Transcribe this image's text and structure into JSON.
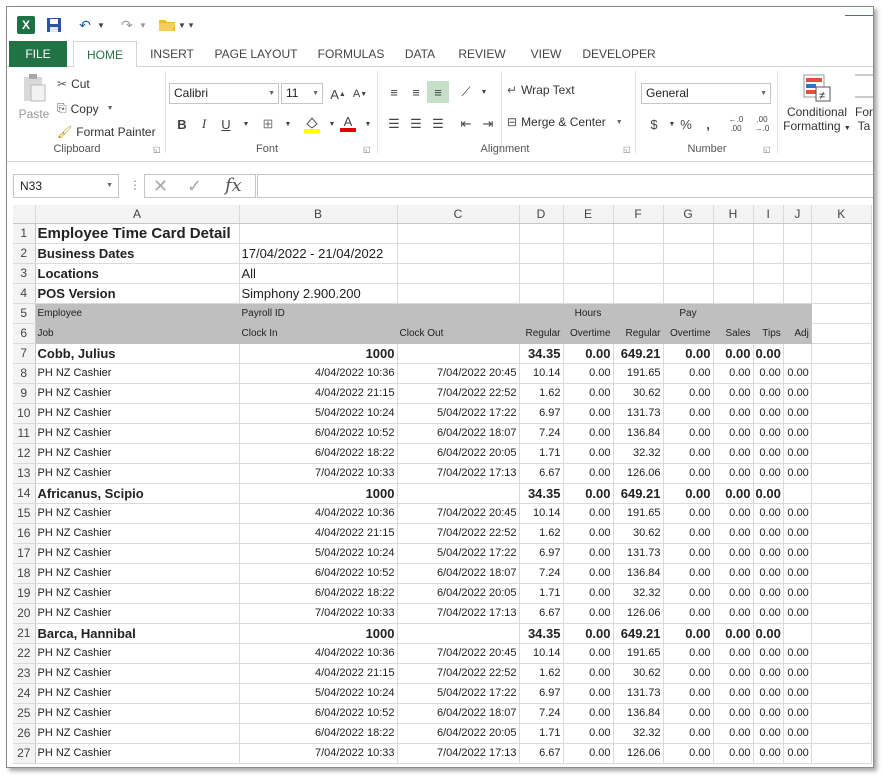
{
  "qat": {
    "app_icon": "X"
  },
  "tabs": [
    "FILE",
    "HOME",
    "INSERT",
    "PAGE LAYOUT",
    "FORMULAS",
    "DATA",
    "REVIEW",
    "VIEW",
    "DEVELOPER"
  ],
  "ribbon": {
    "paste": "Paste",
    "cut": "Cut",
    "copy": "Copy",
    "format_painter": "Format Painter",
    "clipboard": "Clipboard",
    "font_name": "Calibri",
    "font_size": "11",
    "grow": "A",
    "shrink": "A",
    "bold": "B",
    "italic": "I",
    "underline": "U",
    "font_color": "A",
    "font": "Font",
    "wrap_text": "Wrap Text",
    "merge_center": "Merge & Center",
    "alignment": "Alignment",
    "number_format": "General",
    "currency": "$",
    "percent": "%",
    "comma": ",",
    "inc_decimal": "←.0 .00",
    "dec_decimal": ".00 →.0",
    "number": "Number",
    "conditional": "Conditional",
    "formatting": "Formatting",
    "format_as": "For",
    "table": "Ta"
  },
  "formula_bar": {
    "name_box": "N33",
    "fx": "fx",
    "value": ""
  },
  "columns": [
    "A",
    "B",
    "C",
    "D",
    "E",
    "F",
    "G",
    "H",
    "I",
    "J",
    "K"
  ],
  "title": "Employee Time Card Detail",
  "info": [
    {
      "label": "Business Dates",
      "value": "17/04/2022 - 21/04/2022"
    },
    {
      "label": "Locations",
      "value": "All"
    },
    {
      "label": "POS Version",
      "value": "Simphony 2.900.200"
    }
  ],
  "header1": {
    "a": "Employee",
    "b": "Payroll ID",
    "hours": "Hours",
    "pay": "Pay"
  },
  "header2": {
    "a": "Job",
    "b": "Clock In",
    "c": "Clock Out",
    "d": "Regular",
    "e": "Overtime",
    "f": "Regular",
    "g": "Overtime",
    "h": "Sales",
    "i": "Tips",
    "j": "Adj"
  },
  "employees": [
    {
      "name": "Cobb, Julius",
      "payroll_id": "1000",
      "reg_hours": "34.35",
      "ot_hours": "0.00",
      "reg_pay": "649.21",
      "ot_pay": "0.00",
      "sales": "0.00",
      "tips": "0.00",
      "rows": [
        {
          "job": "PH NZ Cashier",
          "in": "4/04/2022 10:36",
          "out": "7/04/2022 20:45",
          "reg": "10.14",
          "ot": "0.00",
          "regpay": "191.65",
          "otpay": "0.00",
          "sales": "0.00",
          "tips": "0.00",
          "adj": "0.00"
        },
        {
          "job": "PH NZ Cashier",
          "in": "4/04/2022 21:15",
          "out": "7/04/2022 22:52",
          "reg": "1.62",
          "ot": "0.00",
          "regpay": "30.62",
          "otpay": "0.00",
          "sales": "0.00",
          "tips": "0.00",
          "adj": "0.00"
        },
        {
          "job": "PH NZ Cashier",
          "in": "5/04/2022 10:24",
          "out": "5/04/2022 17:22",
          "reg": "6.97",
          "ot": "0.00",
          "regpay": "131.73",
          "otpay": "0.00",
          "sales": "0.00",
          "tips": "0.00",
          "adj": "0.00"
        },
        {
          "job": "PH NZ Cashier",
          "in": "6/04/2022 10:52",
          "out": "6/04/2022 18:07",
          "reg": "7.24",
          "ot": "0.00",
          "regpay": "136.84",
          "otpay": "0.00",
          "sales": "0.00",
          "tips": "0.00",
          "adj": "0.00"
        },
        {
          "job": "PH NZ Cashier",
          "in": "6/04/2022 18:22",
          "out": "6/04/2022 20:05",
          "reg": "1.71",
          "ot": "0.00",
          "regpay": "32.32",
          "otpay": "0.00",
          "sales": "0.00",
          "tips": "0.00",
          "adj": "0.00"
        },
        {
          "job": "PH NZ Cashier",
          "in": "7/04/2022 10:33",
          "out": "7/04/2022 17:13",
          "reg": "6.67",
          "ot": "0.00",
          "regpay": "126.06",
          "otpay": "0.00",
          "sales": "0.00",
          "tips": "0.00",
          "adj": "0.00"
        }
      ]
    },
    {
      "name": "Africanus, Scipio",
      "payroll_id": "1000",
      "reg_hours": "34.35",
      "ot_hours": "0.00",
      "reg_pay": "649.21",
      "ot_pay": "0.00",
      "sales": "0.00",
      "tips": "0.00",
      "rows": [
        {
          "job": "PH NZ Cashier",
          "in": "4/04/2022 10:36",
          "out": "7/04/2022 20:45",
          "reg": "10.14",
          "ot": "0.00",
          "regpay": "191.65",
          "otpay": "0.00",
          "sales": "0.00",
          "tips": "0.00",
          "adj": "0.00"
        },
        {
          "job": "PH NZ Cashier",
          "in": "4/04/2022 21:15",
          "out": "7/04/2022 22:52",
          "reg": "1.62",
          "ot": "0.00",
          "regpay": "30.62",
          "otpay": "0.00",
          "sales": "0.00",
          "tips": "0.00",
          "adj": "0.00"
        },
        {
          "job": "PH NZ Cashier",
          "in": "5/04/2022 10:24",
          "out": "5/04/2022 17:22",
          "reg": "6.97",
          "ot": "0.00",
          "regpay": "131.73",
          "otpay": "0.00",
          "sales": "0.00",
          "tips": "0.00",
          "adj": "0.00"
        },
        {
          "job": "PH NZ Cashier",
          "in": "6/04/2022 10:52",
          "out": "6/04/2022 18:07",
          "reg": "7.24",
          "ot": "0.00",
          "regpay": "136.84",
          "otpay": "0.00",
          "sales": "0.00",
          "tips": "0.00",
          "adj": "0.00"
        },
        {
          "job": "PH NZ Cashier",
          "in": "6/04/2022 18:22",
          "out": "6/04/2022 20:05",
          "reg": "1.71",
          "ot": "0.00",
          "regpay": "32.32",
          "otpay": "0.00",
          "sales": "0.00",
          "tips": "0.00",
          "adj": "0.00"
        },
        {
          "job": "PH NZ Cashier",
          "in": "7/04/2022 10:33",
          "out": "7/04/2022 17:13",
          "reg": "6.67",
          "ot": "0.00",
          "regpay": "126.06",
          "otpay": "0.00",
          "sales": "0.00",
          "tips": "0.00",
          "adj": "0.00"
        }
      ]
    },
    {
      "name": "Barca, Hannibal",
      "payroll_id": "1000",
      "reg_hours": "34.35",
      "ot_hours": "0.00",
      "reg_pay": "649.21",
      "ot_pay": "0.00",
      "sales": "0.00",
      "tips": "0.00",
      "rows": [
        {
          "job": "PH NZ Cashier",
          "in": "4/04/2022 10:36",
          "out": "7/04/2022 20:45",
          "reg": "10.14",
          "ot": "0.00",
          "regpay": "191.65",
          "otpay": "0.00",
          "sales": "0.00",
          "tips": "0.00",
          "adj": "0.00"
        },
        {
          "job": "PH NZ Cashier",
          "in": "4/04/2022 21:15",
          "out": "7/04/2022 22:52",
          "reg": "1.62",
          "ot": "0.00",
          "regpay": "30.62",
          "otpay": "0.00",
          "sales": "0.00",
          "tips": "0.00",
          "adj": "0.00"
        },
        {
          "job": "PH NZ Cashier",
          "in": "5/04/2022 10:24",
          "out": "5/04/2022 17:22",
          "reg": "6.97",
          "ot": "0.00",
          "regpay": "131.73",
          "otpay": "0.00",
          "sales": "0.00",
          "tips": "0.00",
          "adj": "0.00"
        },
        {
          "job": "PH NZ Cashier",
          "in": "6/04/2022 10:52",
          "out": "6/04/2022 18:07",
          "reg": "7.24",
          "ot": "0.00",
          "regpay": "136.84",
          "otpay": "0.00",
          "sales": "0.00",
          "tips": "0.00",
          "adj": "0.00"
        },
        {
          "job": "PH NZ Cashier",
          "in": "6/04/2022 18:22",
          "out": "6/04/2022 20:05",
          "reg": "1.71",
          "ot": "0.00",
          "regpay": "32.32",
          "otpay": "0.00",
          "sales": "0.00",
          "tips": "0.00",
          "adj": "0.00"
        },
        {
          "job": "PH NZ Cashier",
          "in": "7/04/2022 10:33",
          "out": "7/04/2022 17:13",
          "reg": "6.67",
          "ot": "0.00",
          "regpay": "126.06",
          "otpay": "0.00",
          "sales": "0.00",
          "tips": "0.00",
          "adj": "0.00"
        }
      ]
    }
  ]
}
